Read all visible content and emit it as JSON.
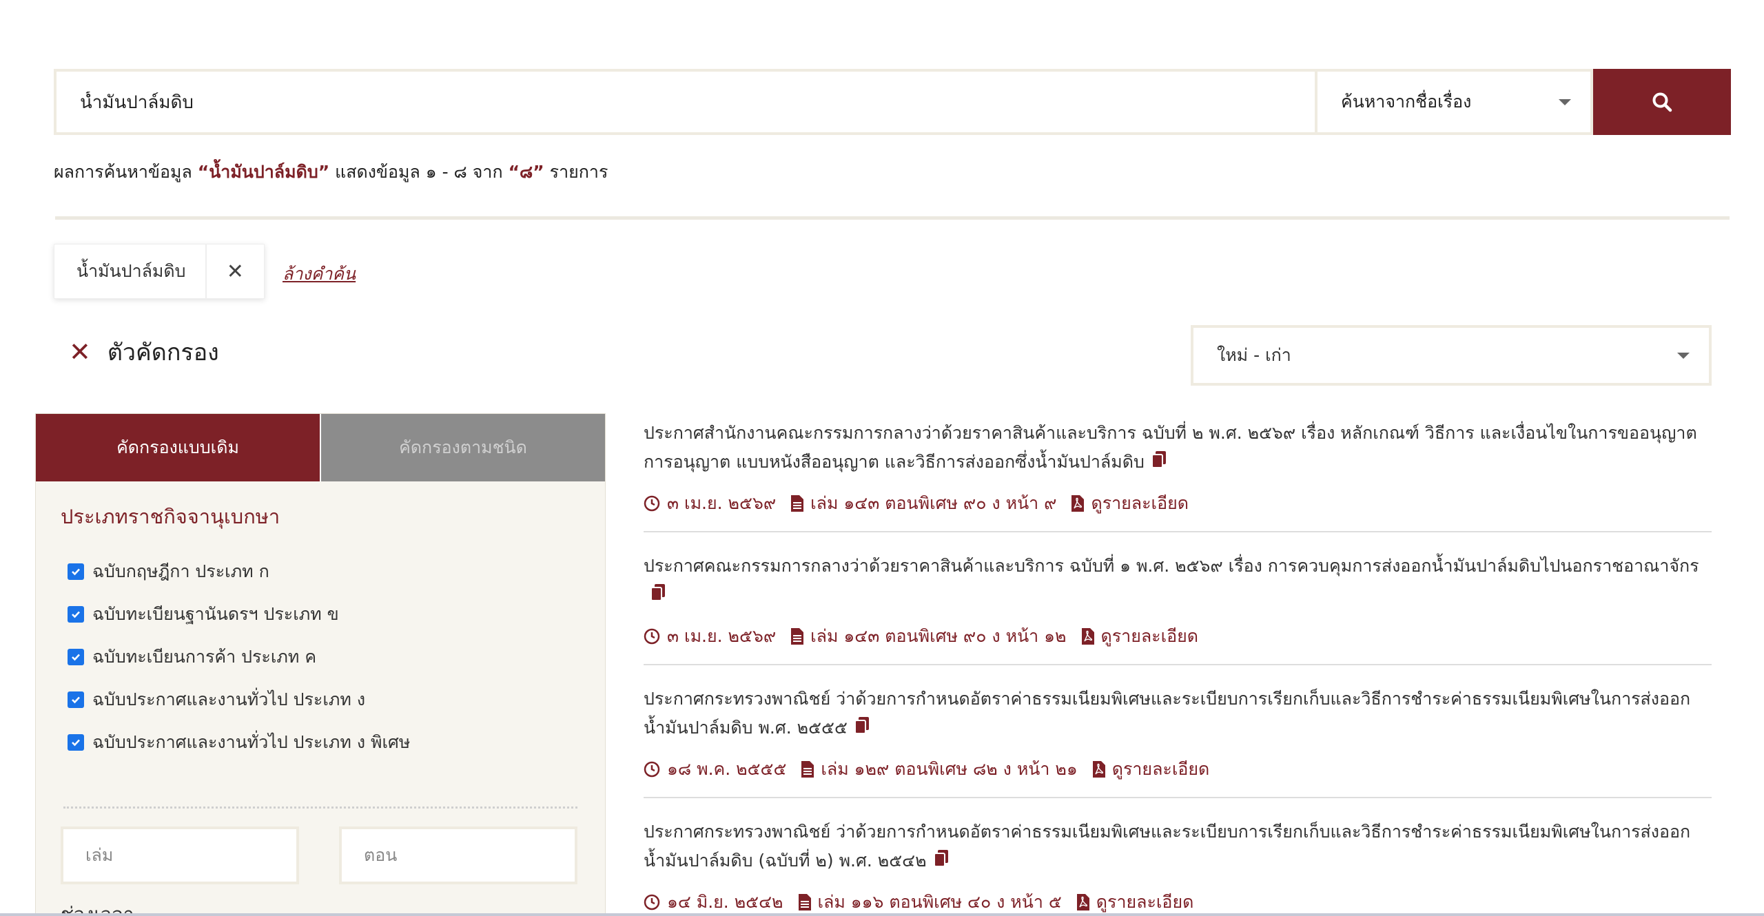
{
  "search": {
    "query": "น้ำมันปาล์มดิบ",
    "type_selected": "ค้นหาจากชื่อเรื่อง"
  },
  "summary": {
    "prefix": "ผลการค้นหาข้อมูล",
    "query_quoted": "“น้ำมันปาล์มดิบ”",
    "middle": "แสดงข้อมูล ๑ - ๘ จาก",
    "total_quoted": "“๘”",
    "suffix": "รายการ"
  },
  "tag": {
    "label": "น้ำมันปาล์มดิบ",
    "remove": "✕"
  },
  "clear_link": "ล้างคำค้น",
  "filter": {
    "title": "ตัวคัดกรอง",
    "tabs": [
      "คัดกรองแบบเดิม",
      "คัดกรองตามชนิด"
    ],
    "section_heading": "ประเภทราชกิจจานุเบกษา",
    "checkboxes": [
      "ฉบับกฤษฎีกา ประเภท ก",
      "ฉบับทะเบียนฐานันดรฯ ประเภท ข",
      "ฉบับทะเบียนการค้า ประเภท ค",
      "ฉบับประกาศและงานทั่วไป ประเภท ง",
      "ฉบับประกาศและงานทั่วไป ประเภท ง พิเศษ"
    ],
    "volume_placeholder": "เล่ม",
    "section_placeholder": "ตอน",
    "period_label": "ช่วงเวลา"
  },
  "sort": {
    "selected": "ใหม่ - เก่า"
  },
  "results": [
    {
      "title": "ประกาศสำนักงานคณะกรรมการกลางว่าด้วยราคาสินค้าและบริการ ฉบับที่ ๒ พ.ศ. ๒๕๖๙ เรื่อง หลักเกณฑ์ วิธีการ และเงื่อนไขในการขออนุญาต การอนุญาต แบบหนังสืออนุญาต และวิธีการส่งออกซึ่งน้ำมันปาล์มดิบ",
      "date": "๓ เม.ย. ๒๕๖๙",
      "ref": "เล่ม ๑๔๓ ตอนพิเศษ ๙๐ ง หน้า ๙",
      "detail": "ดูรายละเอียด"
    },
    {
      "title": "ประกาศคณะกรรมการกลางว่าด้วยราคาสินค้าและบริการ ฉบับที่ ๑ พ.ศ. ๒๕๖๙ เรื่อง การควบคุมการส่งออกน้ำมันปาล์มดิบไปนอกราชอาณาจักร",
      "date": "๓ เม.ย. ๒๕๖๙",
      "ref": "เล่ม ๑๔๓ ตอนพิเศษ ๙๐ ง หน้า ๑๒",
      "detail": "ดูรายละเอียด"
    },
    {
      "title": "ประกาศกระทรวงพาณิชย์ ว่าด้วยการกำหนดอัตราค่าธรรมเนียมพิเศษและระเบียบการเรียกเก็บและวิธีการชำระค่าธรรมเนียมพิเศษในการส่งออกน้ำมันปาล์มดิบ พ.ศ. ๒๕๕๕",
      "date": "๑๘ พ.ค. ๒๕๕๕",
      "ref": "เล่ม ๑๒๙ ตอนพิเศษ ๘๒ ง หน้า ๒๑",
      "detail": "ดูรายละเอียด"
    },
    {
      "title": "ประกาศกระทรวงพาณิชย์ ว่าด้วยการกำหนดอัตราค่าธรรมเนียมพิเศษและระเบียบการเรียกเก็บและวิธีการชำระค่าธรรมเนียมพิเศษในการส่งออกน้ำมันปาล์มดิบ (ฉบับที่ ๒) พ.ศ. ๒๕๔๒",
      "date": "๑๔ มิ.ย. ๒๕๔๒",
      "ref": "เล่ม ๑๑๖ ตอนพิเศษ ๔๐ ง หน้า ๕",
      "detail": "ดูรายละเอียด"
    }
  ],
  "colors": {
    "brand": "#7d2127",
    "border": "#efebe0",
    "checkbox": "#1a73e8"
  }
}
